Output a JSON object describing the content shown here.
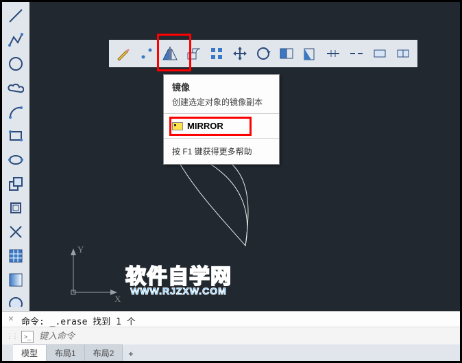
{
  "left_toolbar": [
    {
      "name": "line-tool"
    },
    {
      "name": "polyline-tool"
    },
    {
      "name": "circle-tool"
    },
    {
      "name": "cloud-tool"
    },
    {
      "name": "arc-tool"
    },
    {
      "name": "rectangle-tool"
    },
    {
      "name": "ellipse-tool"
    },
    {
      "name": "copy-tool"
    },
    {
      "name": "offset-tool"
    },
    {
      "name": "trim-tool"
    },
    {
      "name": "hatch-tool"
    },
    {
      "name": "gradient-tool"
    },
    {
      "name": "region-tool"
    }
  ],
  "top_toolbar": [
    {
      "name": "draw-tool"
    },
    {
      "name": "point-tool"
    },
    {
      "name": "mirror-tool",
      "highlight": true
    },
    {
      "name": "rotate-tool"
    },
    {
      "name": "array-tool"
    },
    {
      "name": "move-tool"
    },
    {
      "name": "scale-circ-tool"
    },
    {
      "name": "stretch-tool"
    },
    {
      "name": "stretch2-tool"
    },
    {
      "name": "extend-tool"
    },
    {
      "name": "break-tool"
    },
    {
      "name": "break2-tool"
    },
    {
      "name": "join-tool"
    }
  ],
  "tooltip": {
    "title": "镜像",
    "desc": "创建选定对象的镜像副本",
    "command": "MIRROR",
    "help": "按 F1 键获得更多帮助"
  },
  "axis": {
    "x": "X",
    "y": "Y"
  },
  "watermark": {
    "line1": "软件自学网",
    "line2": "WWW.RJZXW.COM"
  },
  "command_history": "命令: _.erase 找到 1 个",
  "command_input_placeholder": "键入命令",
  "tabs": [
    {
      "label": "模型",
      "active": true
    },
    {
      "label": "布局1",
      "active": false
    },
    {
      "label": "布局2",
      "active": false
    }
  ],
  "tabs_add": "+"
}
